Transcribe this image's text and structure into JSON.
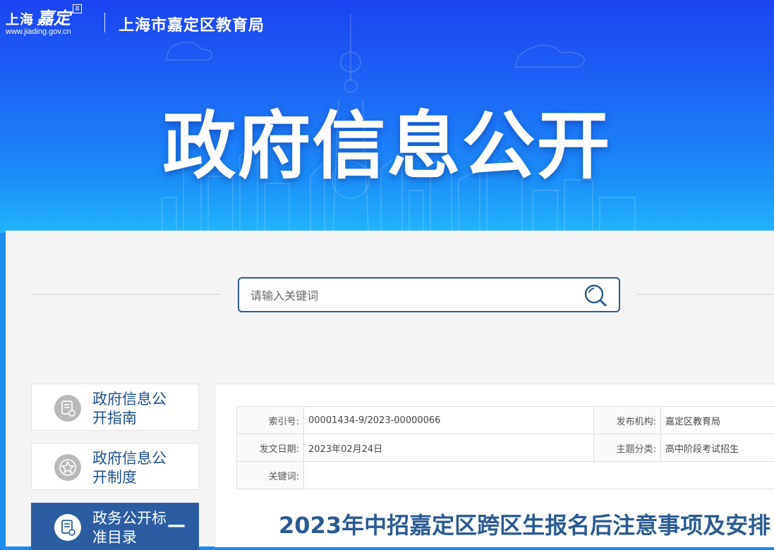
{
  "header": {
    "logo_text": "上海",
    "logo_script": "嘉定",
    "logo_seal": "嘉",
    "logo_url": "www.jiading.gov.cn",
    "bureau": "上海市嘉定区教育局",
    "hero_title": "政府信息公开"
  },
  "search": {
    "placeholder": "请输入关键词"
  },
  "sidebar": {
    "items": [
      {
        "label": "政府信息公开指南",
        "icon": "document-icon",
        "active": false
      },
      {
        "label": "政府信息公开制度",
        "icon": "star-icon",
        "active": false
      },
      {
        "label": "政务公开标准目录",
        "icon": "document-icon",
        "active": true,
        "toggle": "—"
      }
    ]
  },
  "meta": {
    "index_label": "索引号:",
    "index_value": "00001434-9/2023-00000066",
    "publisher_label": "发布机构:",
    "publisher_value": "嘉定区教育局",
    "date_label": "发文日期:",
    "date_value": "2023年02月24日",
    "topic_label": "主题分类:",
    "topic_value": "高中阶段考试招生",
    "keyword_label": "关键词:",
    "keyword_value": ""
  },
  "article": {
    "title": "2023年中招嘉定区跨区生报名后注意事项及安排"
  },
  "colors": {
    "hero_top": "#1a44f2",
    "hero_bottom": "#22b4fb",
    "accent": "#2b5da3",
    "title_text": "#2c5a92"
  }
}
